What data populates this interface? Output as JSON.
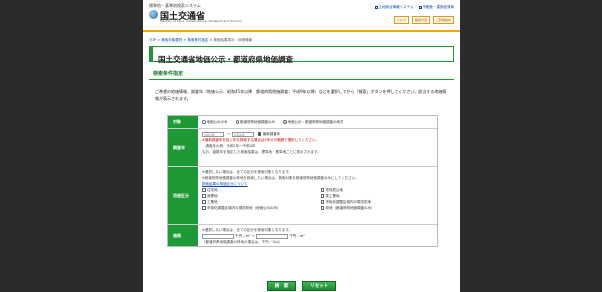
{
  "header": {
    "tagline": "標準地・基準地検索システム",
    "logo_title": "国土交通省",
    "logo_sub": "Ministry of Land, Infrastructure, Transport and Tourism",
    "links": [
      "土地総合情報システム",
      "不動産・建設経済局"
    ],
    "small_buttons": [
      "ヘルプ",
      "検索方法",
      "ご利用案内"
    ]
  },
  "breadcrumb": {
    "items": [
      "TOP",
      "検索対象選択",
      "検索条件指定"
    ],
    "current": "検索結果表示・詳細情報"
  },
  "page_title": "国土交通省地価公示・都道府県地価調査",
  "section_title": "検索条件指定",
  "intro": "ご希望の地価情報、調査年（地価公示：昭和45年以降　都道府県地価調査：平成9年以降）などを選択してから「検索」ボタンを押してください。該当する地価情報が表示されます。",
  "form": {
    "target": {
      "label": "対象",
      "options": [
        {
          "text": "地価公示のみ",
          "selected": false
        },
        {
          "text": "都道府県地価調査のみ",
          "selected": false
        },
        {
          "text": "地価公示・都道府県地価調査の両方",
          "selected": true
        }
      ]
    },
    "year": {
      "label": "調査年",
      "from_value": "令和4年",
      "to_value": "令和4年",
      "latest_label": "最新調査年",
      "latest_checked": true,
      "notes": [
        "※最新調査年を除く年を検索する場合は5年分の範囲で選択してください。",
        "　調査年の例：令和2年～令和4年",
        "なお、複数年を指定した検索結果は、標準地・基準地ごとに表示されます。"
      ]
    },
    "usage": {
      "label": "用途区分",
      "notes": [
        "※選択しない場合は、全ての区分を検索対象となります。",
        "※都道府県地価調査の林地を検索したい場合は、検索対象を都道府県地価調査のみにしてください。"
      ],
      "link": "検索結果の用途区分について",
      "options": [
        "住宅地",
        "宅地見込地",
        "商業地",
        "準工業地",
        "工業地",
        "市街化調整区域内の現況宅地",
        "市街化調整区域内の現況林地（地価公示のみ）",
        "林地（都道府県地価調査のみ）"
      ]
    },
    "price": {
      "label": "価格",
      "note": "※選択しない場合は、全ての区分を検索対象となります。",
      "unit_from": "千円／m²",
      "separator": "～",
      "unit_to": "千円／m²",
      "unit_note": "（都道府県地価調査の林地の場合は、千円／10a）"
    }
  },
  "buttons": {
    "search": "検　索",
    "reset": "リセット"
  }
}
